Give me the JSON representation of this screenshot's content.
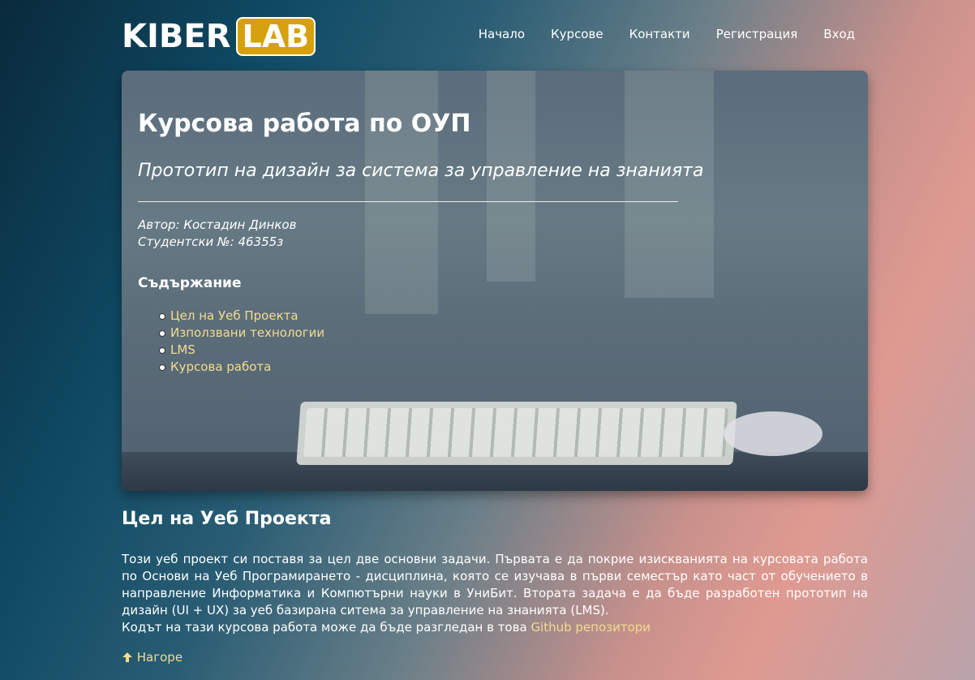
{
  "logo": {
    "part1": "KIBER",
    "part2": "LAB"
  },
  "nav": [
    "Начало",
    "Курсове",
    "Контакти",
    "Регистрация",
    "Вход"
  ],
  "hero": {
    "title": "Курсова работа по ОУП",
    "subtitle": "Прототип на дизайн за система за управление на знанията",
    "author": "Автор: Костадин Динков",
    "student_no": "Студентски №: 46355з",
    "toc_title": "Съдържание",
    "toc": [
      "Цел на Уеб Проекта",
      "Използвани технологии",
      "LMS",
      "Курсова работа"
    ]
  },
  "section": {
    "heading": "Цел на Уеб Проекта",
    "paragraph": "Този уеб проект си поставя за цел две основни задачи. Първата е да покрие изискванията на курсовата работа по Основи на Уеб Програмирането - дисциплина, която се изучава в първи семестър като част от обучението в направление Информатика и Компютърни науки в УниБит. Втората задача е да бъде разработен прототип на дизайн (UI + UX) за уеб базирана ситема за управление на знанията (LMS).",
    "repo_prefix": "Кодът на тази курсова работа може да бъде разгледан в това",
    "repo_link": "Github репозитори",
    "back_to_top": "Нагоре"
  },
  "colors": {
    "accent": "#d6a10d",
    "link": "#f3dc8c"
  }
}
